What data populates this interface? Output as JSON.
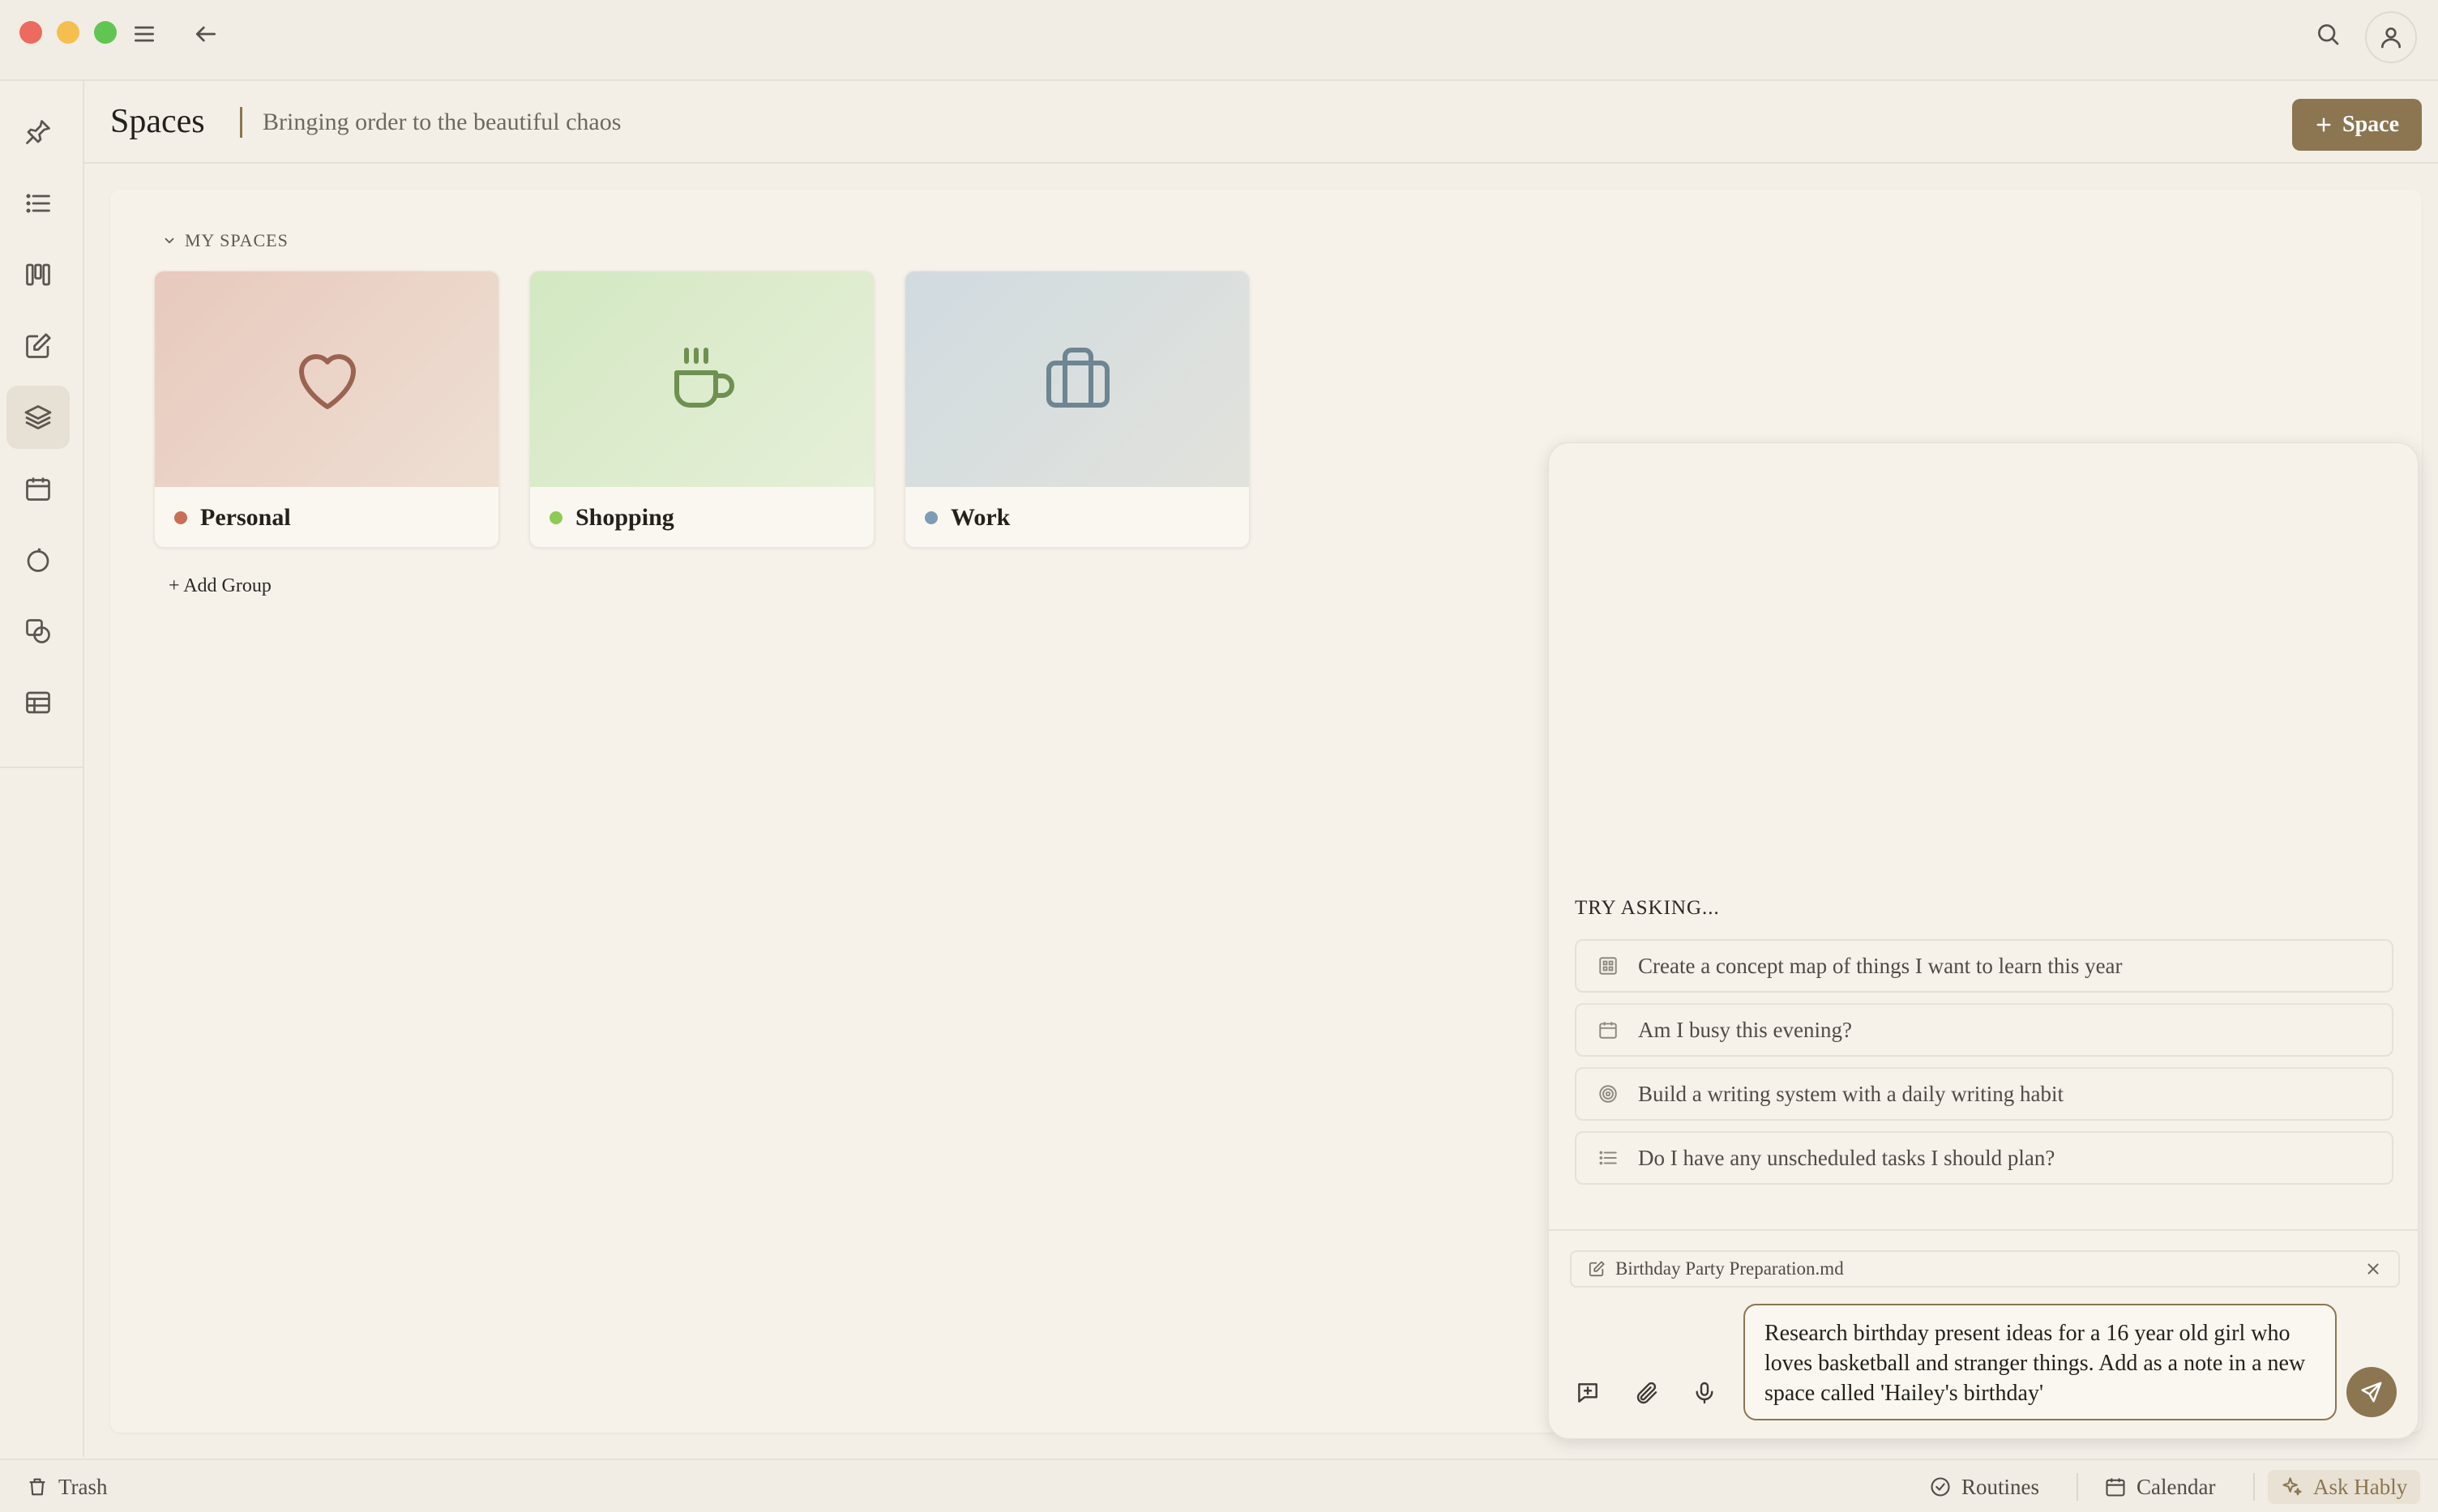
{
  "header": {
    "title": "Spaces",
    "subtitle": "Bringing order to the beautiful chaos",
    "add_space_label": "Space"
  },
  "spaces": {
    "section_label": "MY SPACES",
    "add_group_label": "+ Add Group",
    "cards": [
      {
        "name": "Personal",
        "icon": "heart-icon",
        "dot_color": "#c96f55"
      },
      {
        "name": "Shopping",
        "icon": "coffee-cup-icon",
        "dot_color": "#8fca54"
      },
      {
        "name": "Work",
        "icon": "briefcase-icon",
        "dot_color": "#7f9cb6"
      }
    ]
  },
  "sidebar": {
    "items": [
      {
        "icon": "pin-icon"
      },
      {
        "icon": "list-icon"
      },
      {
        "icon": "kanban-icon"
      },
      {
        "icon": "edit-icon"
      },
      {
        "icon": "layers-icon",
        "active": true
      },
      {
        "icon": "calendar-icon"
      },
      {
        "icon": "circle-icon"
      },
      {
        "icon": "shapes-icon"
      },
      {
        "icon": "table-icon"
      }
    ]
  },
  "chat": {
    "try_label": "TRY ASKING...",
    "suggestions": [
      {
        "icon": "concept-map-icon",
        "text": "Create a concept map of things I want to learn this year"
      },
      {
        "icon": "calendar-icon",
        "text": "Am I busy this evening?"
      },
      {
        "icon": "target-icon",
        "text": "Build a writing system with a daily writing habit"
      },
      {
        "icon": "list-icon",
        "text": "Do I have any unscheduled tasks I should plan?"
      }
    ],
    "attachment": "Birthday Party Preparation.md",
    "input_value": "Research birthday present ideas for a 16 year old girl who loves basketball and stranger things. Add as a note in a new space called 'Hailey's birthday'"
  },
  "statusbar": {
    "trash": "Trash",
    "routines": "Routines",
    "calendar": "Calendar",
    "ask": "Ask Hably"
  },
  "colors": {
    "accent": "#8b7651",
    "background": "#f3efe7"
  }
}
